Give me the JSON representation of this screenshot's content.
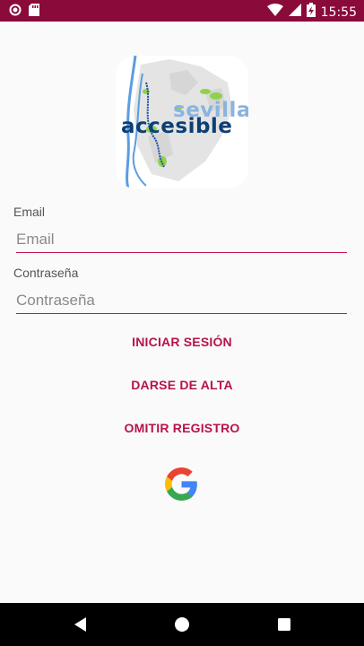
{
  "status_bar": {
    "time": "15:55",
    "left_icons": [
      "notification-icon",
      "sd-card-icon"
    ],
    "right_icons": [
      "wifi-icon",
      "signal-icon",
      "battery-charging-icon"
    ],
    "color": "#8a0a3a"
  },
  "logo": {
    "line1": "sevilla",
    "line2": "accesible"
  },
  "form": {
    "email_label": "Email",
    "email_placeholder": "Email",
    "password_label": "Contraseña",
    "password_placeholder": "Contraseña"
  },
  "actions": {
    "login": "INICIAR SESIÓN",
    "signup": "DARSE DE ALTA",
    "skip": "OMITIR REGISTRO",
    "google_icon": "google-icon"
  },
  "nav_bar": {
    "buttons": [
      "back-icon",
      "home-icon",
      "recents-icon"
    ]
  },
  "colors": {
    "accent": "#b8124d",
    "underline": "#c0154f",
    "background": "#fafafa"
  }
}
